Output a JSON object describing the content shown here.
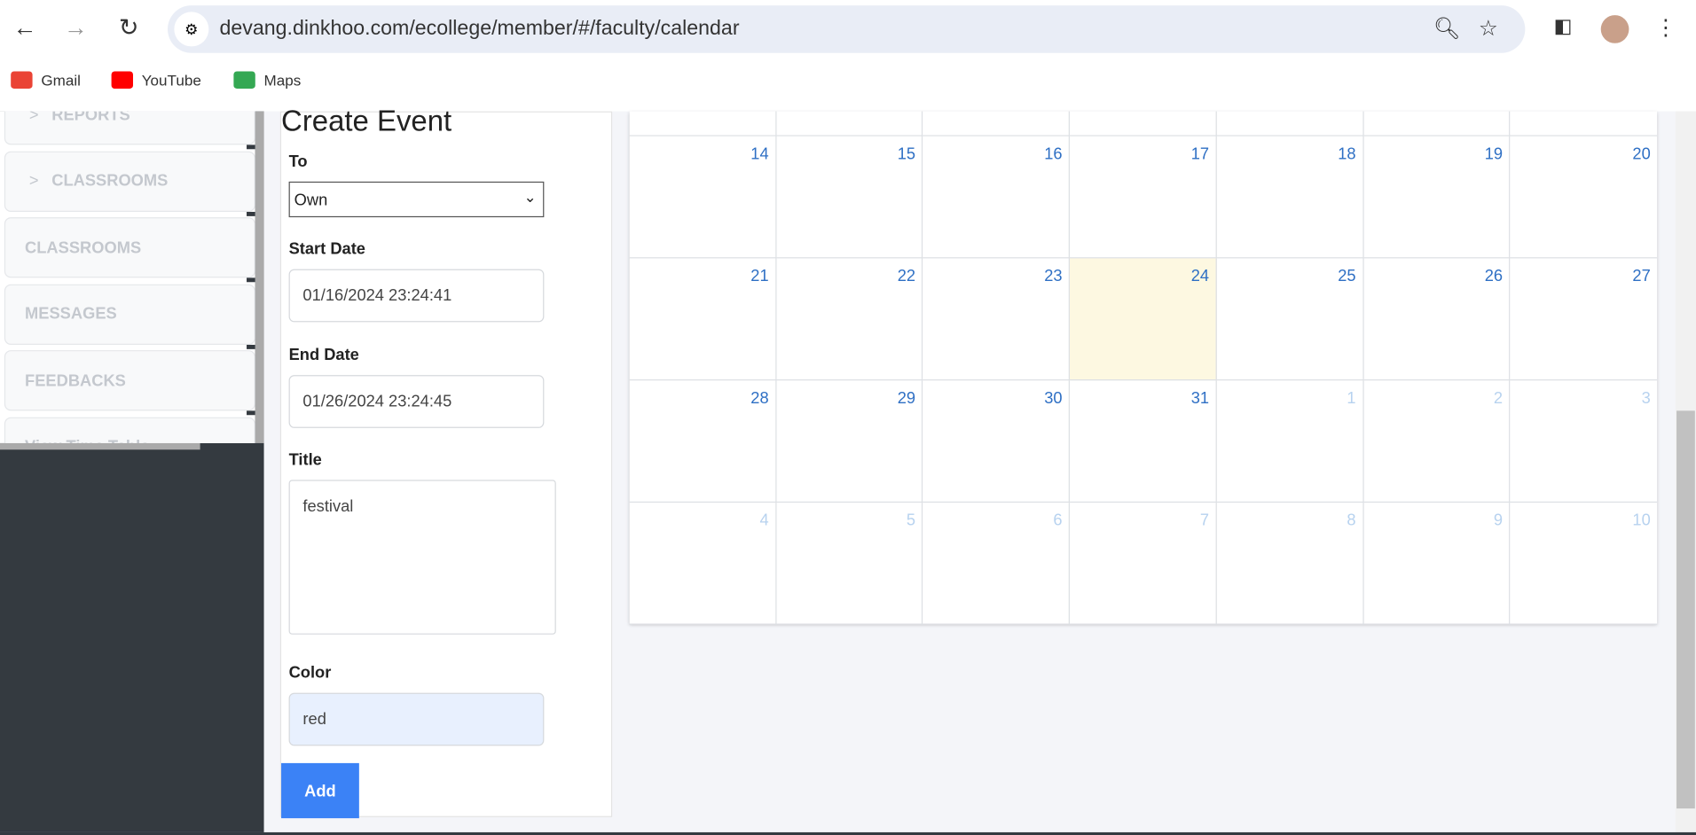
{
  "browser": {
    "url": "devang.dinkhoo.com/ecollege/member/#/faculty/calendar",
    "bookmarks": [
      {
        "label": "Gmail",
        "color": "#ea4335"
      },
      {
        "label": "YouTube",
        "color": "#ff0000"
      },
      {
        "label": "Maps",
        "color": "#34a853"
      }
    ]
  },
  "sidebar": {
    "items": [
      {
        "label": "REPORTS",
        "chevron": true
      },
      {
        "label": "CLASSROOMS",
        "chevron": true
      },
      {
        "label": "CLASSROOMS"
      },
      {
        "label": "MESSAGES"
      },
      {
        "label": "FEEDBACKS"
      },
      {
        "label": "View Time Table"
      }
    ]
  },
  "form": {
    "title": "Create Event",
    "to_label": "To",
    "to_value": "Own",
    "start_label": "Start Date",
    "start_value": "01/16/2024 23:24:41",
    "end_label": "End Date",
    "end_value": "01/26/2024 23:24:45",
    "title_label": "Title",
    "title_value": "festival",
    "color_label": "Color",
    "color_value": "red",
    "add_label": "Add",
    "accent": "#3b82f6"
  },
  "calendar": {
    "today": "24",
    "weeks": [
      [
        {
          "d": "",
          "o": false
        },
        {
          "d": "",
          "o": false
        },
        {
          "d": "",
          "o": false
        },
        {
          "d": "",
          "o": false
        },
        {
          "d": "",
          "o": false
        },
        {
          "d": "",
          "o": false
        },
        {
          "d": "",
          "o": false
        }
      ],
      [
        {
          "d": "14"
        },
        {
          "d": "15"
        },
        {
          "d": "16"
        },
        {
          "d": "17"
        },
        {
          "d": "18"
        },
        {
          "d": "19"
        },
        {
          "d": "20"
        }
      ],
      [
        {
          "d": "21"
        },
        {
          "d": "22"
        },
        {
          "d": "23"
        },
        {
          "d": "24"
        },
        {
          "d": "25"
        },
        {
          "d": "26"
        },
        {
          "d": "27"
        }
      ],
      [
        {
          "d": "28"
        },
        {
          "d": "29"
        },
        {
          "d": "30"
        },
        {
          "d": "31"
        },
        {
          "d": "1",
          "o": true
        },
        {
          "d": "2",
          "o": true
        },
        {
          "d": "3",
          "o": true
        }
      ],
      [
        {
          "d": "4",
          "o": true
        },
        {
          "d": "5",
          "o": true
        },
        {
          "d": "6",
          "o": true
        },
        {
          "d": "7",
          "o": true
        },
        {
          "d": "8",
          "o": true
        },
        {
          "d": "9",
          "o": true
        },
        {
          "d": "10",
          "o": true
        }
      ]
    ]
  }
}
